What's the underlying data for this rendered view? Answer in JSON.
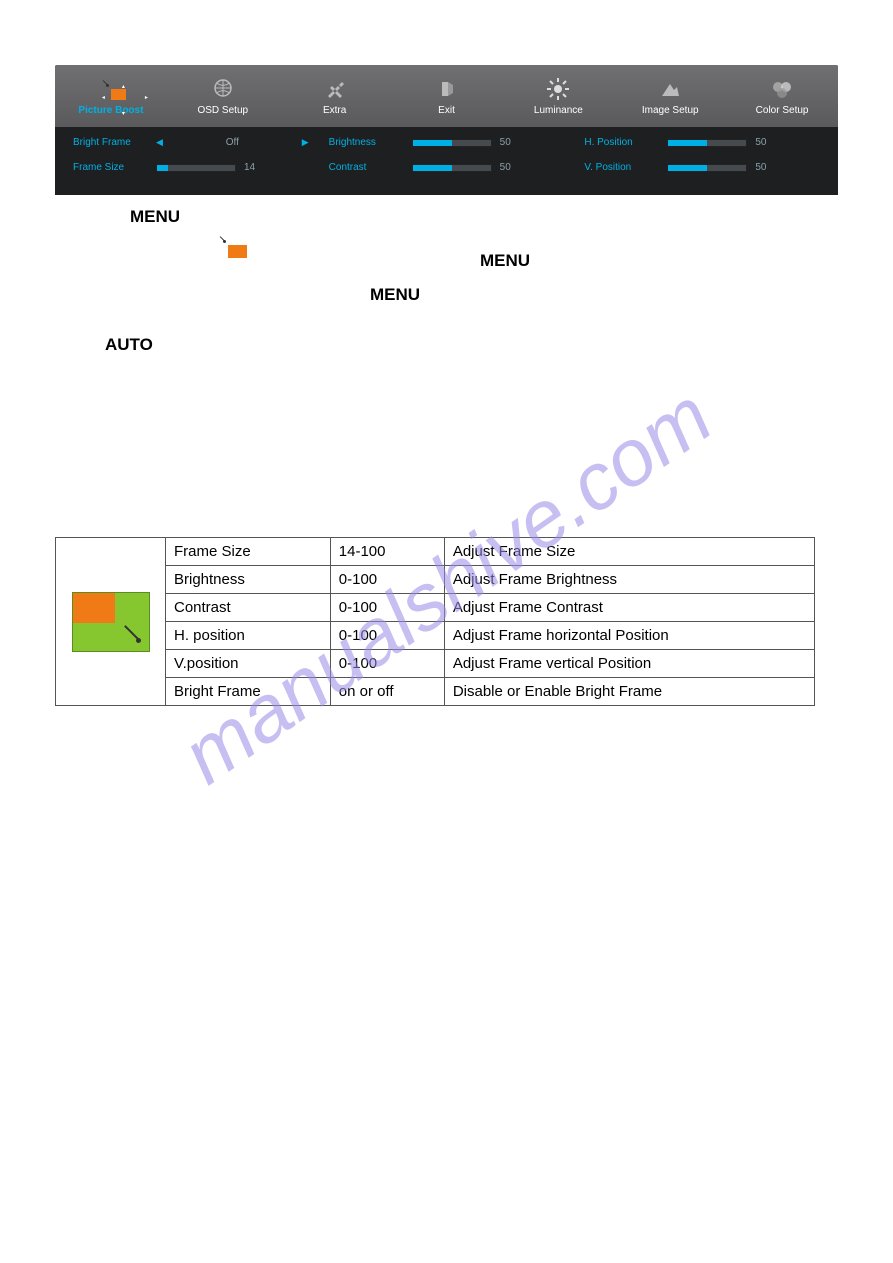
{
  "osd": {
    "tabs": [
      {
        "label": "Picture Boost",
        "active": true
      },
      {
        "label": "OSD Setup"
      },
      {
        "label": "Extra"
      },
      {
        "label": "Exit"
      },
      {
        "label": "Luminance"
      },
      {
        "label": "Image Setup"
      },
      {
        "label": "Color Setup"
      }
    ],
    "col1": {
      "bright_frame_label": "Bright Frame",
      "bright_frame_value": "Off",
      "frame_size_label": "Frame Size",
      "frame_size_value": "14"
    },
    "col2": {
      "brightness_label": "Brightness",
      "brightness_value": "50",
      "contrast_label": "Contrast",
      "contrast_value": "50"
    },
    "col3": {
      "hpos_label": "H. Position",
      "hpos_value": "50",
      "vpos_label": "V. Position",
      "vpos_value": "50"
    }
  },
  "labels": {
    "menu": "MENU",
    "auto": "AUTO"
  },
  "table": [
    {
      "name": "Frame Size",
      "range": "14-100",
      "desc": "Adjust Frame Size"
    },
    {
      "name": "Brightness",
      "range": "0-100",
      "desc": "Adjust Frame Brightness"
    },
    {
      "name": "Contrast",
      "range": "0-100",
      "desc": "Adjust Frame Contrast"
    },
    {
      "name": "H. position",
      "range": "0-100",
      "desc": "Adjust Frame horizontal Position"
    },
    {
      "name": "V.position",
      "range": "0-100",
      "desc": "Adjust Frame vertical Position"
    },
    {
      "name": "Bright Frame",
      "range": "on or off",
      "desc": "Disable or Enable Bright Frame"
    }
  ],
  "watermark": "manualshive.com"
}
